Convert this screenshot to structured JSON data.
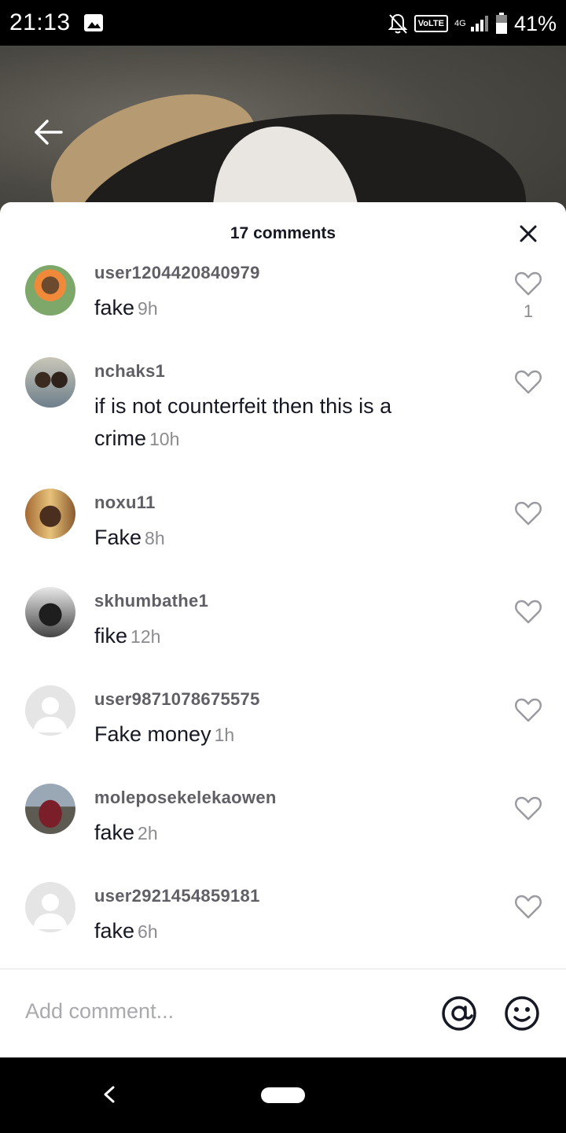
{
  "status_bar": {
    "time": "21:13",
    "volte": "VoLTE",
    "network": "4G",
    "battery": "41%"
  },
  "sheet": {
    "title": "17 comments"
  },
  "comments": [
    {
      "username": "user1204420840979",
      "text": "fake",
      "time": "9h",
      "likes": "1",
      "avatar": "photo"
    },
    {
      "username": "nchaks1",
      "text": "if is not counterfeit then this is a crime",
      "time": "10h",
      "likes": "",
      "avatar": "photo"
    },
    {
      "username": "noxu11",
      "text": "Fake",
      "time": "8h",
      "likes": "",
      "avatar": "photo"
    },
    {
      "username": "skhumbathe1",
      "text": "fike",
      "time": "12h",
      "likes": "",
      "avatar": "photo"
    },
    {
      "username": "user9871078675575",
      "text": "Fake money",
      "time": "1h",
      "likes": "",
      "avatar": "default"
    },
    {
      "username": "moleposekelekaowen",
      "text": "fake",
      "time": "2h",
      "likes": "",
      "avatar": "photo"
    },
    {
      "username": "user2921454859181",
      "text": "fake",
      "time": "6h",
      "likes": "",
      "avatar": "default"
    }
  ],
  "input": {
    "placeholder": "Add comment..."
  },
  "icons": {
    "back": "arrow-left-icon",
    "close": "close-icon",
    "like": "heart-outline-icon",
    "mention": "at-sign-icon",
    "emoji": "smiley-icon"
  },
  "colors": {
    "text_primary": "#161823",
    "text_secondary": "#8a8b91",
    "username": "#5f5f66"
  }
}
